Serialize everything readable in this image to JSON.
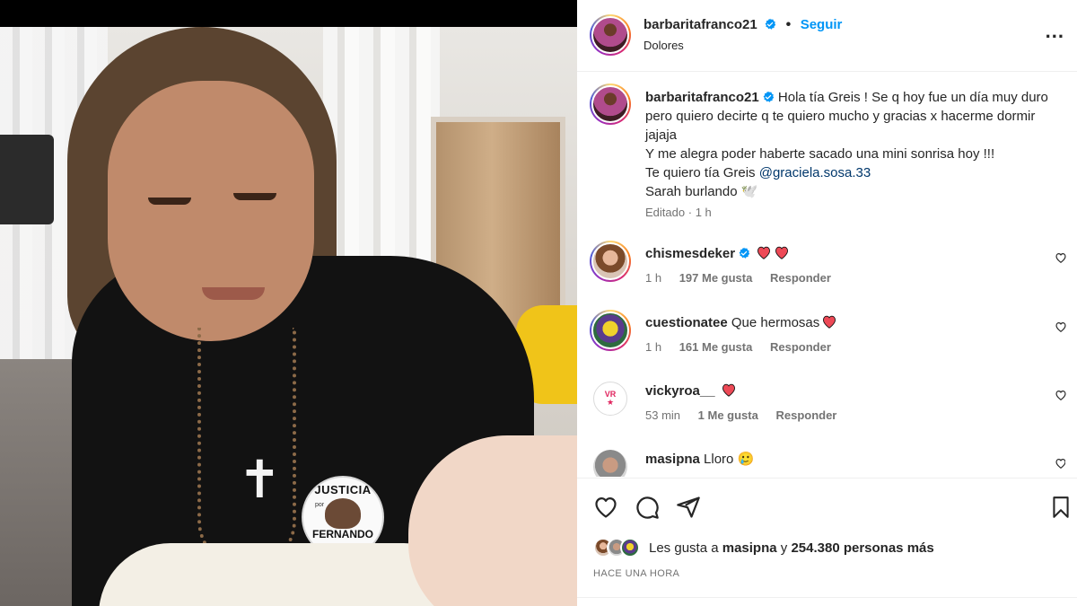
{
  "post": {
    "photo_pin": {
      "top": "JUSTICIA",
      "mid": "por",
      "bottom": "FERNANDO"
    }
  },
  "header": {
    "username": "barbaritafranco21",
    "separator": "•",
    "follow_label": "Seguir",
    "location": "Dolores",
    "more_label": "..."
  },
  "caption": {
    "username": "barbaritafranco21",
    "line1": "Hola tía Greis ! Se q hoy fue un día muy duro pero quiero decirte q te quiero mucho y gracias x hacerme dormir jajaja",
    "line2": "Y me alegra poder haberte sacado una mini sonrisa hoy !!!",
    "line3_prefix": "Te quiero tía Greis ",
    "mention": "@graciela.sosa.33",
    "line4": "Sarah burlando 🕊️",
    "edited": "Editado",
    "dot": "·",
    "time": "1 h"
  },
  "comments": [
    {
      "username": "chismesdeker",
      "verified": true,
      "text": "",
      "hearts": 2,
      "time": "1 h",
      "likes": "197 Me gusta",
      "reply": "Responder"
    },
    {
      "username": "cuestionatee",
      "verified": false,
      "text": "Que hermosas",
      "hearts": 1,
      "time": "1 h",
      "likes": "161 Me gusta",
      "reply": "Responder"
    },
    {
      "username": "vickyroa__",
      "verified": false,
      "text": "",
      "hearts": 1,
      "time": "53 min",
      "likes": "1 Me gusta",
      "reply": "Responder"
    },
    {
      "username": "masipna",
      "verified": false,
      "text": "Lloro 🥲",
      "hearts": 0,
      "time": "",
      "likes": "",
      "reply": ""
    }
  ],
  "likes": {
    "prefix": "Les gusta a ",
    "user": "masipna",
    "middle": " y ",
    "count": "254.380 personas más"
  },
  "timestamp": "HACE UNA HORA",
  "colors": {
    "link": "#0095f6",
    "mention": "#00376b",
    "muted": "#737373",
    "heart": "#ed4956"
  },
  "icons": [
    "verified-badge-icon",
    "more-options-icon",
    "heart-icon",
    "comment-icon",
    "share-icon",
    "save-bookmark-icon",
    "red-heart-icon"
  ]
}
